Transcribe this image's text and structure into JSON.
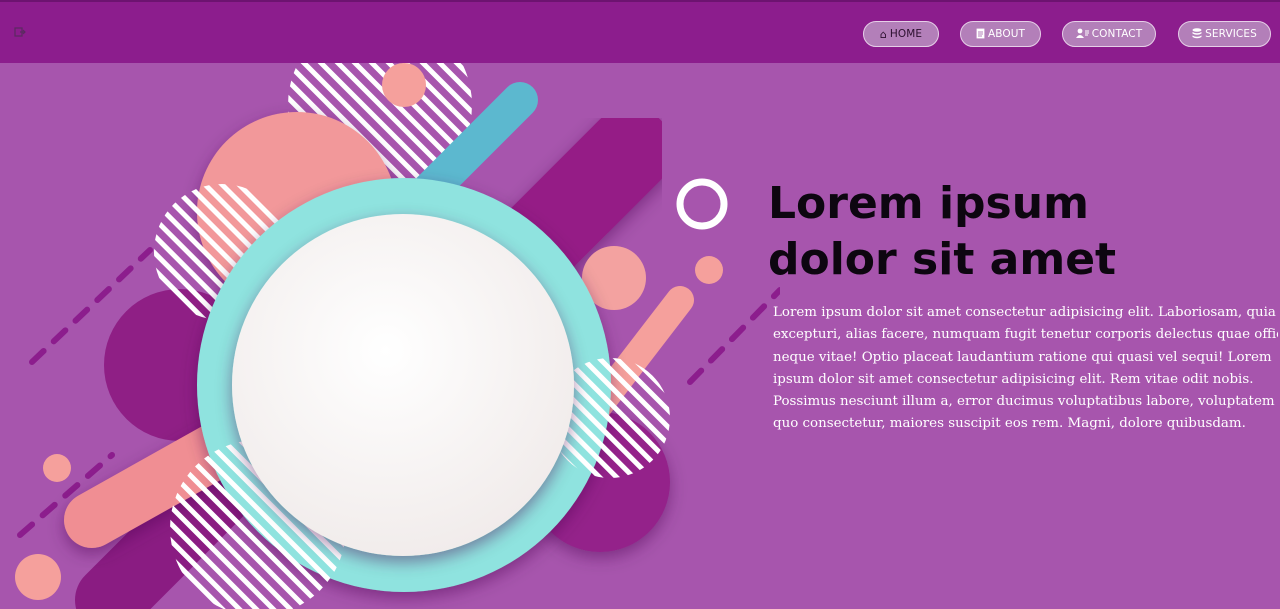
{
  "header": {
    "menu_icon": "logout-icon",
    "nav": [
      {
        "label": "HOME",
        "icon": "home-icon",
        "active": true
      },
      {
        "label": "ABOUT",
        "icon": "document-icon",
        "active": false
      },
      {
        "label": "CONTACT",
        "icon": "contacts-icon",
        "active": false
      },
      {
        "label": "SERVICES",
        "icon": "database-icon",
        "active": false
      }
    ]
  },
  "hero": {
    "title_line1": "Lorem ipsum",
    "title_line2": "dolor sit amet",
    "body_lines": [
      "Lorem ipsum dolor sit amet consectetur adipisicing elit. Laboriosam, quia",
      "excepturi, alias facere, numquam fugit tenetur corporis delectus quae officia",
      "neque vitae! Optio placeat laudantium ratione qui quasi vel sequi! Lorem",
      "ipsum dolor sit amet consectetur adipisicing elit. Rem vitae odit nobis.",
      "Possimus nesciunt illum a, error ducimus voluptatibus labore, voluptatem",
      "quo consectetur, maiores suscipit eos rem. Magni, dolore quibusdam."
    ]
  },
  "colors": {
    "page_bg": "#a755ad",
    "header_bg": "#8c1d8d",
    "teal": "#8fe3df",
    "pink": "#f2989a",
    "magenta": "#951f86",
    "blue": "#5cb8cf"
  }
}
